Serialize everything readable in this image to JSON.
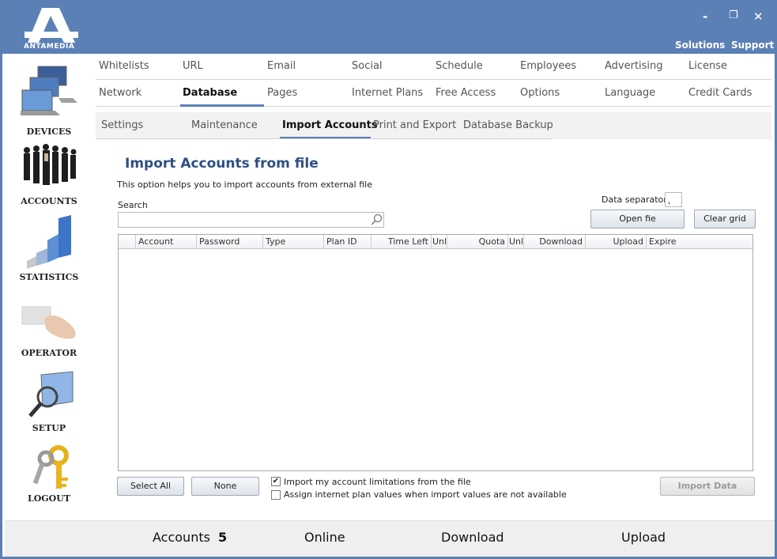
{
  "app": {
    "brand": "ANTAMEDIA",
    "window_controls": {
      "minimize": "-",
      "maximize": "❐",
      "close": "✕"
    },
    "top_links": [
      "Solutions",
      "Support"
    ],
    "colors": {
      "titlebar": "#5b80b6",
      "title_text": "#2f4f82"
    }
  },
  "sidebar": {
    "items": [
      {
        "label": "DEVICES",
        "icon": "computers-icon"
      },
      {
        "label": "ACCOUNTS",
        "icon": "people-icon"
      },
      {
        "label": "STATISTICS",
        "icon": "bar-chart-icon"
      },
      {
        "label": "OPERATOR",
        "icon": "card-hand-icon"
      },
      {
        "label": "SETUP",
        "icon": "magnifier-monitor-icon"
      },
      {
        "label": "LOGOUT",
        "icon": "keys-icon"
      }
    ]
  },
  "nav": {
    "row1": [
      "Whitelists",
      "URL",
      "Email",
      "Social",
      "Schedule",
      "Employees",
      "Advertising",
      "License"
    ],
    "row2": [
      "Network",
      "Database",
      "Pages",
      "Internet Plans",
      "Free Access",
      "Options",
      "Language",
      "Credit Cards"
    ],
    "active": "Database"
  },
  "subnav": {
    "items": [
      "Settings",
      "Maintenance",
      "Import Accounts",
      "Print and Export",
      "Database Backup"
    ],
    "active": "Import Accounts"
  },
  "main": {
    "title": "Import Accounts from file",
    "description": "This option helps you to import accounts from external file",
    "search_label": "Search",
    "search_value": "",
    "data_separator_label": "Data separator",
    "data_separator_value": ",",
    "open_file_button": "Open fie",
    "clear_grid_button": "Clear grid",
    "grid_columns": [
      "Account",
      "Password",
      "Type",
      "Plan ID",
      "Time Left",
      "Unl",
      "Quota",
      "Unl",
      "Download",
      "Upload",
      "Expire"
    ],
    "select_all_button": "Select All",
    "none_button": "None",
    "checkbox_limitations": {
      "label": "Import my account limitations from the file",
      "checked": true
    },
    "checkbox_plan_values": {
      "label": "Assign internet plan values when import values are not available",
      "checked": false
    },
    "import_button": "Import Data"
  },
  "status": {
    "accounts_label": "Accounts",
    "accounts_value": "5",
    "online_label": "Online",
    "download_label": "Download",
    "upload_label": "Upload"
  }
}
